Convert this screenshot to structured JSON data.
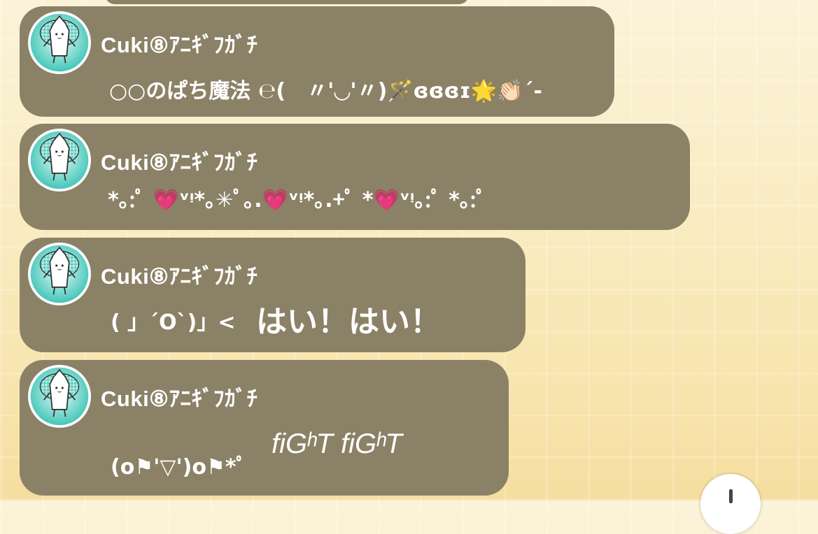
{
  "messages": [
    {
      "sender": "Cuki⑧ｱﾆｷﾞﾌｶﾞﾁ",
      "text": "○○のぱち魔法 ℮(　〃'◡'〃)🪄ɞɞɞɪ🌟👏🏻´-"
    },
    {
      "sender": "Cuki⑧ｱﾆｷﾞﾌｶﾞﾁ",
      "text": "*｡:ﾟ 💗ᵛᵎ*｡✳︎ﾟ｡.💗ᵛᵎ*｡.+ﾟ *💗ᵛᵎ｡:ﾟ *｡:ﾟ"
    },
    {
      "sender": "Cuki⑧ｱﾆｷﾞﾌｶﾞﾁ",
      "text_small": "( 」´O`)」<",
      "text_large": "はい！はい！"
    },
    {
      "sender": "Cuki⑧ｱﾆｷﾞﾌｶﾞﾁ",
      "text_small": "(o⚑'▽')o⚑*ﾟ",
      "text_large": "fiGʰT fiGʰT"
    }
  ],
  "avatar": {
    "icon": "mascot-avatar-icon",
    "color": "#5fd1c4"
  },
  "scroll_button": {
    "icon": "scroll-down-icon"
  },
  "colors": {
    "bubble": "#8b8166",
    "text": "#ffffff"
  }
}
